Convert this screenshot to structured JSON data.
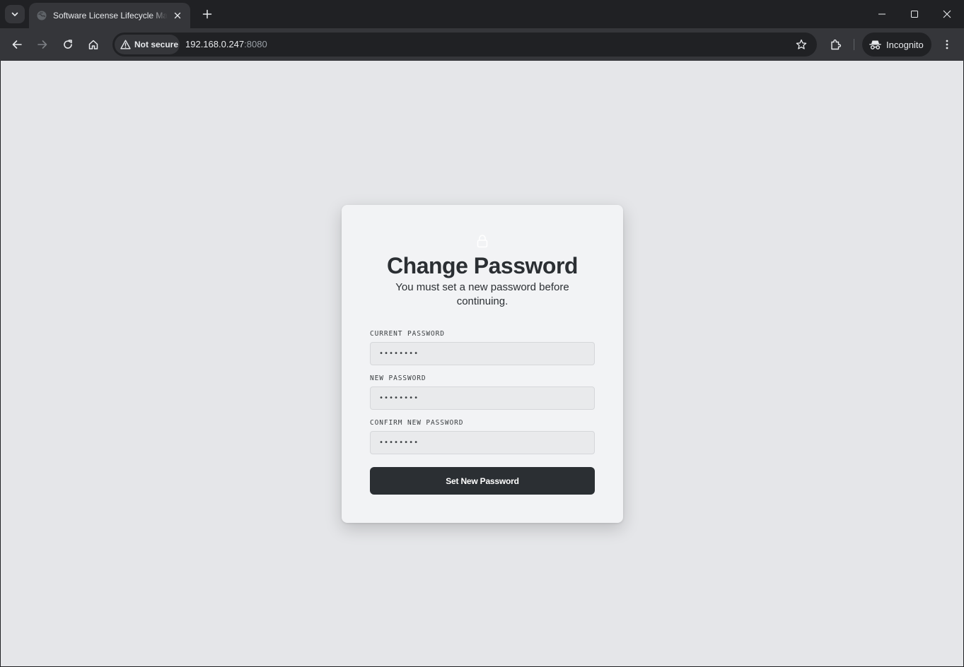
{
  "browser": {
    "tab_title": "Software License Lifecycle Manager",
    "omnibox": {
      "security_label": "Not secure",
      "url_host": "192.168.0.247",
      "url_port": ":8080"
    },
    "profile_label": "Incognito"
  },
  "page": {
    "heading": "Change Password",
    "subtitle": "You must set a new password before continuing.",
    "fields": [
      {
        "label": "CURRENT PASSWORD",
        "placeholder": "••••••••"
      },
      {
        "label": "NEW PASSWORD",
        "placeholder": "••••••••"
      },
      {
        "label": "CONFIRM NEW PASSWORD",
        "placeholder": "••••••••"
      }
    ],
    "submit_label": "Set New Password"
  },
  "colors": {
    "page_bg": "#e5e6e9",
    "card_bg": "#f2f3f5",
    "primary": "#2b2f33",
    "browser_frame": "#202124",
    "toolbar": "#35363a"
  },
  "icons": {
    "tab_search": "chevron-down-icon",
    "favicon": "globe-icon",
    "tab_close": "close-icon",
    "new_tab": "plus-icon",
    "back": "arrow-left-icon",
    "forward": "arrow-right-icon",
    "reload": "reload-icon",
    "home": "home-icon",
    "security": "warning-icon",
    "bookmark": "star-icon",
    "extensions": "puzzle-icon",
    "incognito": "incognito-icon",
    "menu": "kebab-menu-icon",
    "page_lock": "lock-icon"
  }
}
